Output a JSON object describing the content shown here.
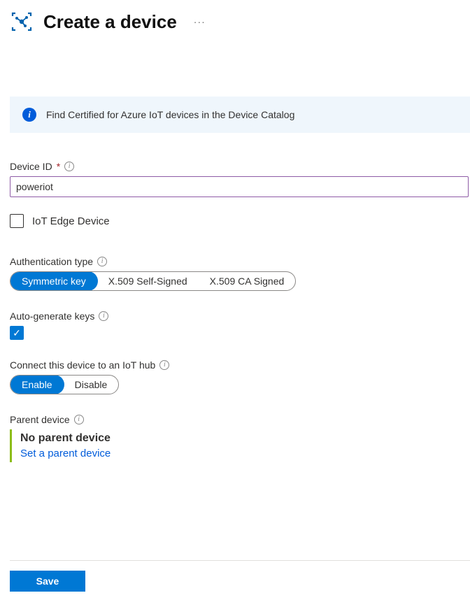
{
  "header": {
    "title": "Create a device",
    "more": "···"
  },
  "info_banner": {
    "text": "Find Certified for Azure IoT devices in the Device Catalog"
  },
  "device_id": {
    "label": "Device ID",
    "required_marker": "*",
    "value": "poweriot"
  },
  "edge": {
    "label": "IoT Edge Device",
    "checked": false
  },
  "auth_type": {
    "label": "Authentication type",
    "options": [
      "Symmetric key",
      "X.509 Self-Signed",
      "X.509 CA Signed"
    ],
    "selected_index": 0
  },
  "autogen": {
    "label": "Auto-generate keys",
    "checked": true
  },
  "connect": {
    "label": "Connect this device to an IoT hub",
    "options": [
      "Enable",
      "Disable"
    ],
    "selected_index": 0
  },
  "parent": {
    "label": "Parent device",
    "none_text": "No parent device",
    "link_text": "Set a parent device"
  },
  "footer": {
    "save": "Save"
  }
}
